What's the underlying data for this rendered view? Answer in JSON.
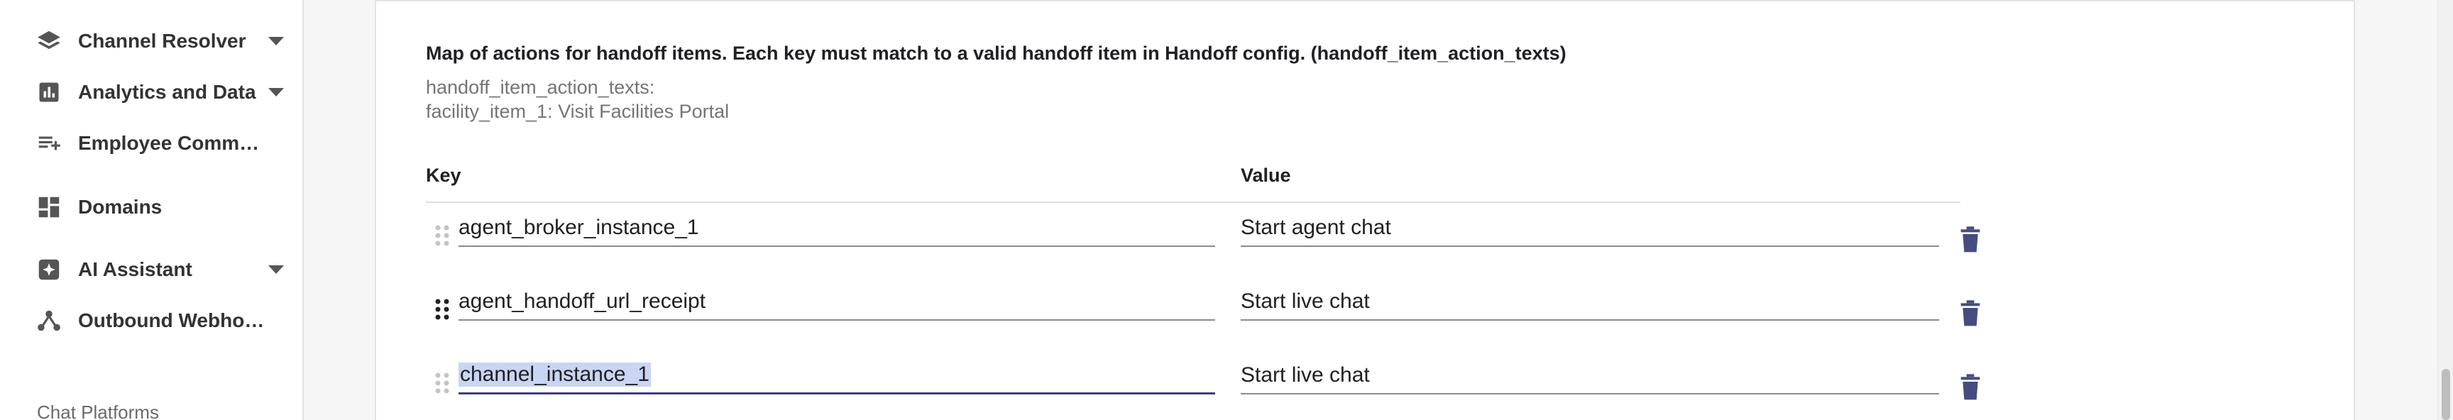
{
  "sidebar": {
    "items": [
      {
        "label": "Channel Resolver",
        "icon": "layers-icon",
        "has_caret": true
      },
      {
        "label": "Analytics and Data",
        "icon": "bar-chart-icon",
        "has_caret": true
      },
      {
        "label": "Employee Commun…",
        "icon": "playlist-add-icon",
        "has_caret": false
      },
      {
        "label": "Domains",
        "icon": "dashboard-icon",
        "has_caret": false
      },
      {
        "label": "AI Assistant",
        "icon": "sparkle-icon",
        "has_caret": true
      },
      {
        "label": "Outbound Webhooks",
        "icon": "webhook-icon",
        "has_caret": false
      }
    ],
    "section_heading": "Chat Platforms"
  },
  "form": {
    "description": "Map of actions for handoff items. Each key must match to a valid handoff item in Handoff config. (handoff_item_action_texts)",
    "preview_line1": "handoff_item_action_texts:",
    "preview_line2": "facility_item_1: Visit Facilities Portal",
    "key_header": "Key",
    "value_header": "Value",
    "rows": [
      {
        "key": "agent_broker_instance_1",
        "value": "Start agent chat"
      },
      {
        "key": "agent_handoff_url_receipt",
        "value": "Start live chat"
      },
      {
        "key": "channel_instance_1",
        "value": "Start live chat"
      }
    ]
  },
  "colors": {
    "accent": "#3f3d83",
    "delete_icon": "#474c80",
    "selection": "#c9d5f3"
  }
}
